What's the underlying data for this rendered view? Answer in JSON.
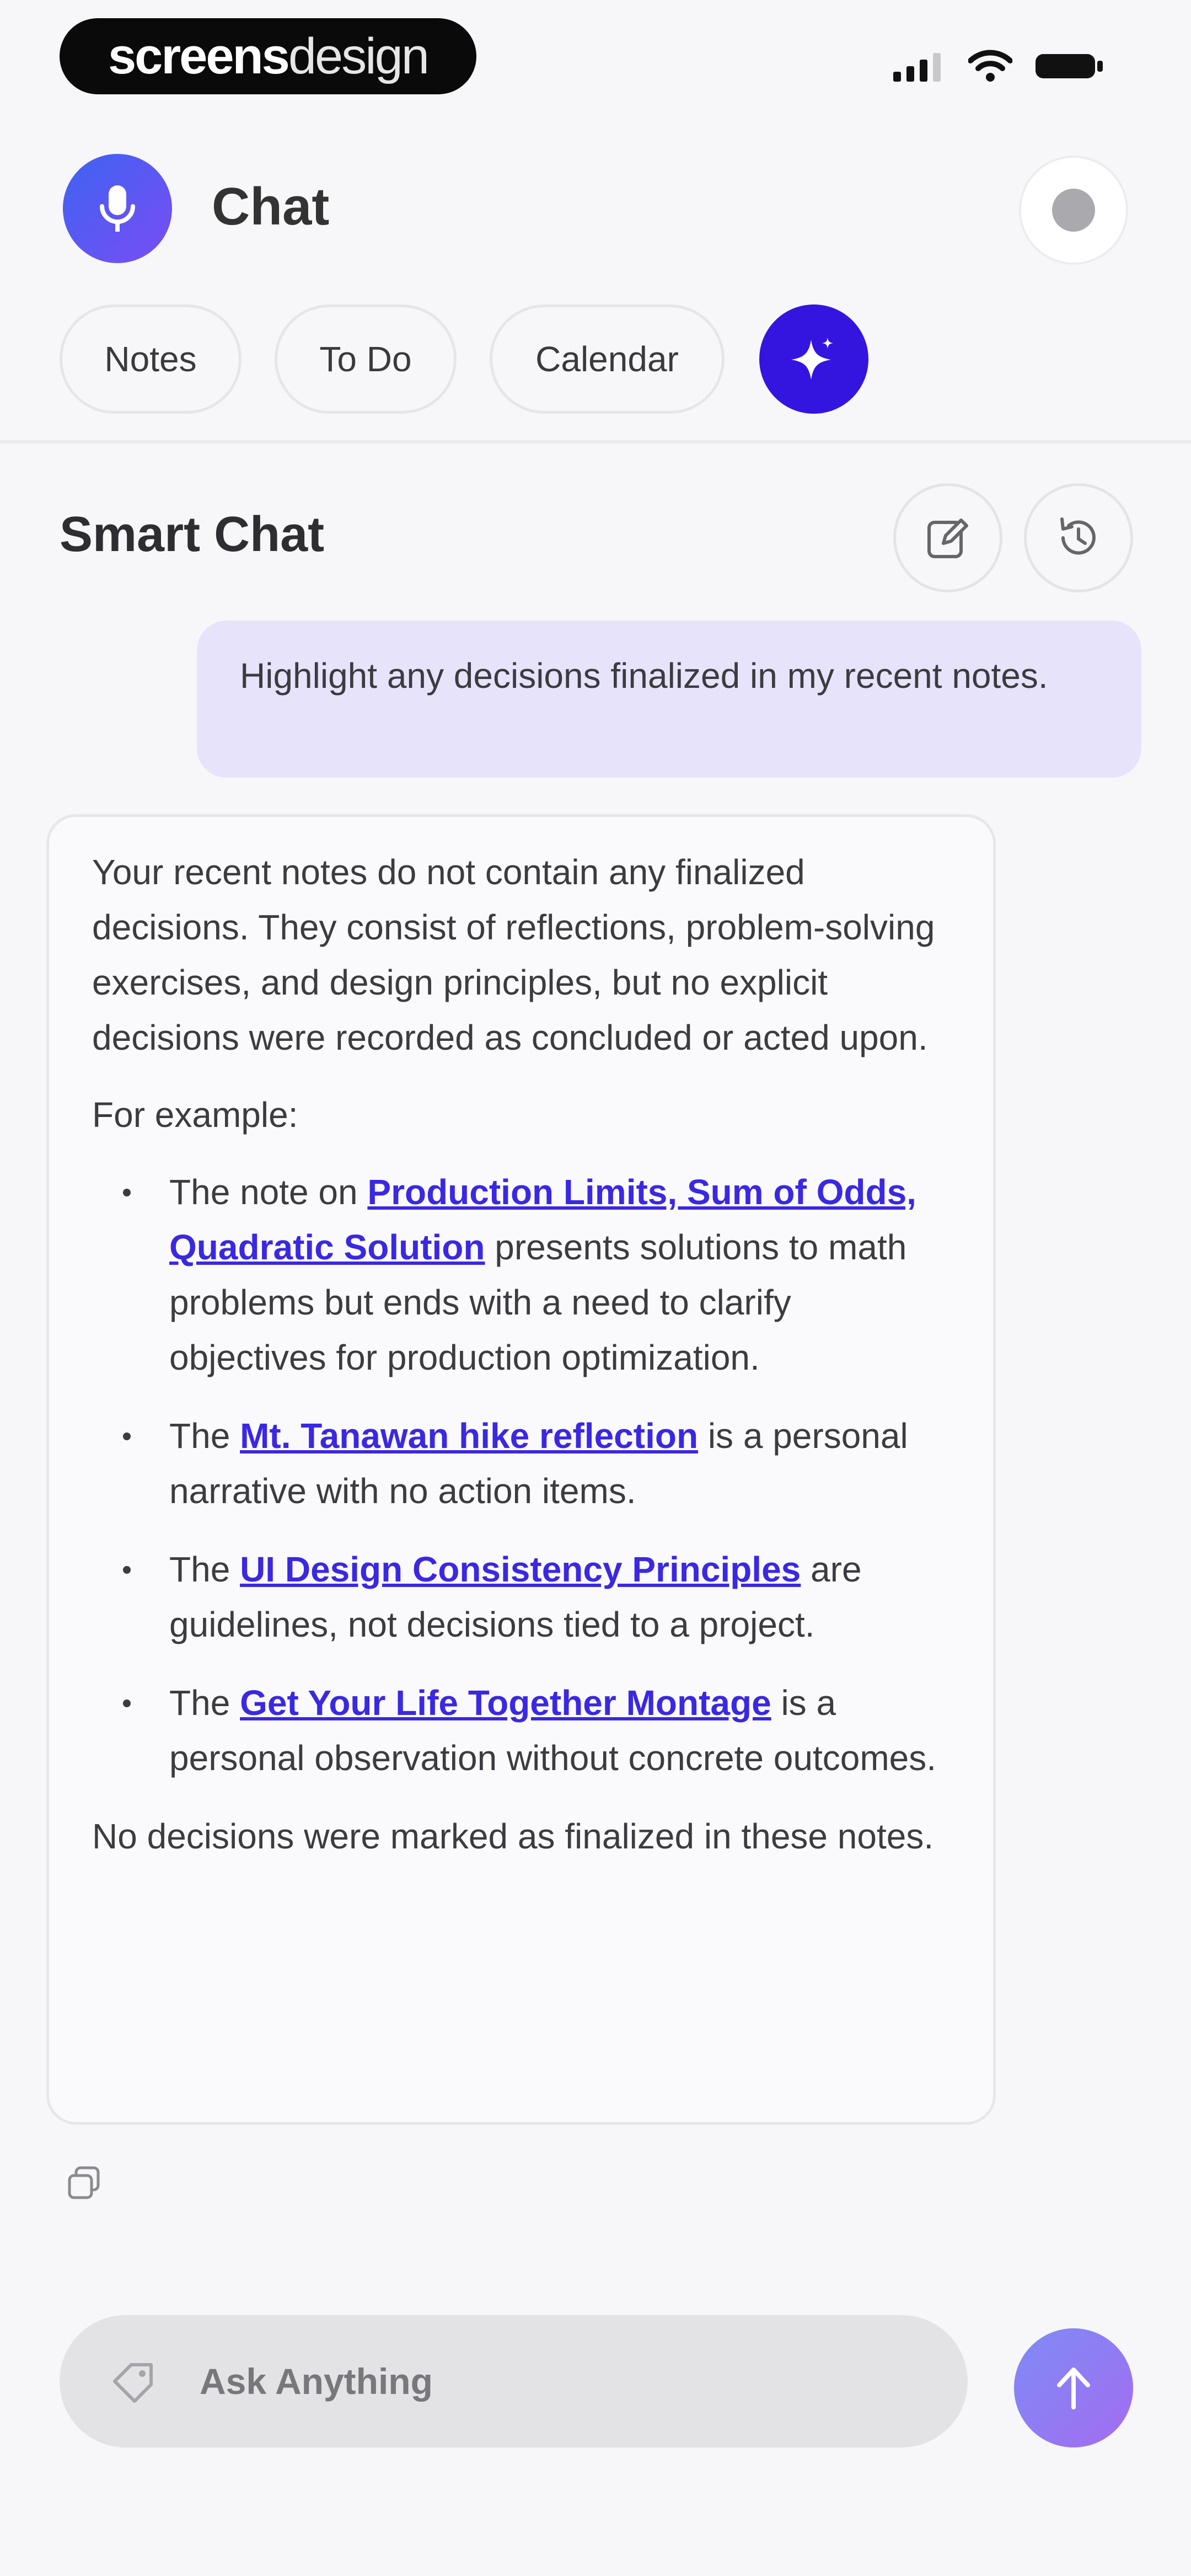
{
  "status_bar": {
    "brand_bold": "screens",
    "brand_light": "design",
    "icons": [
      "signal-icon",
      "wifi-icon",
      "battery-icon"
    ]
  },
  "header": {
    "title": "Chat",
    "avatar_icon": "microphone-icon",
    "settings_icon": "settings-icon"
  },
  "tabs": [
    {
      "label": "Notes"
    },
    {
      "label": "To Do"
    },
    {
      "label": "Calendar"
    }
  ],
  "ai_tab_icon": "sparkle-icon",
  "chat": {
    "title": "Smart Chat",
    "edit_icon": "new-chat-icon",
    "history_icon": "history-icon",
    "user_message": "Highlight any decisions finalized in my recent notes.",
    "reply": {
      "intro": "Your recent notes do not contain any finalized decisions. They consist of reflections, problem-solving exercises, and design principles, but no explicit decisions were recorded as concluded or acted upon.",
      "example_label": "For example:",
      "bullets": [
        {
          "prefix": "The note on ",
          "link": "Production Limits, Sum of Odds, Quadratic Solution",
          "suffix": " presents solutions to math problems but ends with a need to clarify objectives for production optimization."
        },
        {
          "prefix": "The ",
          "link": "Mt. Tanawan hike reflection",
          "suffix": " is a personal narrative with no action items."
        },
        {
          "prefix": "The ",
          "link": "UI Design Consistency Principles",
          "suffix": " are guidelines, not decisions tied to a project."
        },
        {
          "prefix": "The ",
          "link": "Get Your Life Together Montage",
          "suffix": " is a personal observation without concrete outcomes."
        }
      ],
      "conclusion": "No decisions were marked as finalized in these notes."
    }
  },
  "input": {
    "placeholder": "Ask Anything",
    "value": ""
  },
  "colors": {
    "accent": "#3415e0",
    "link": "#3a28e3",
    "user_bubble": "#e7e3fb"
  }
}
